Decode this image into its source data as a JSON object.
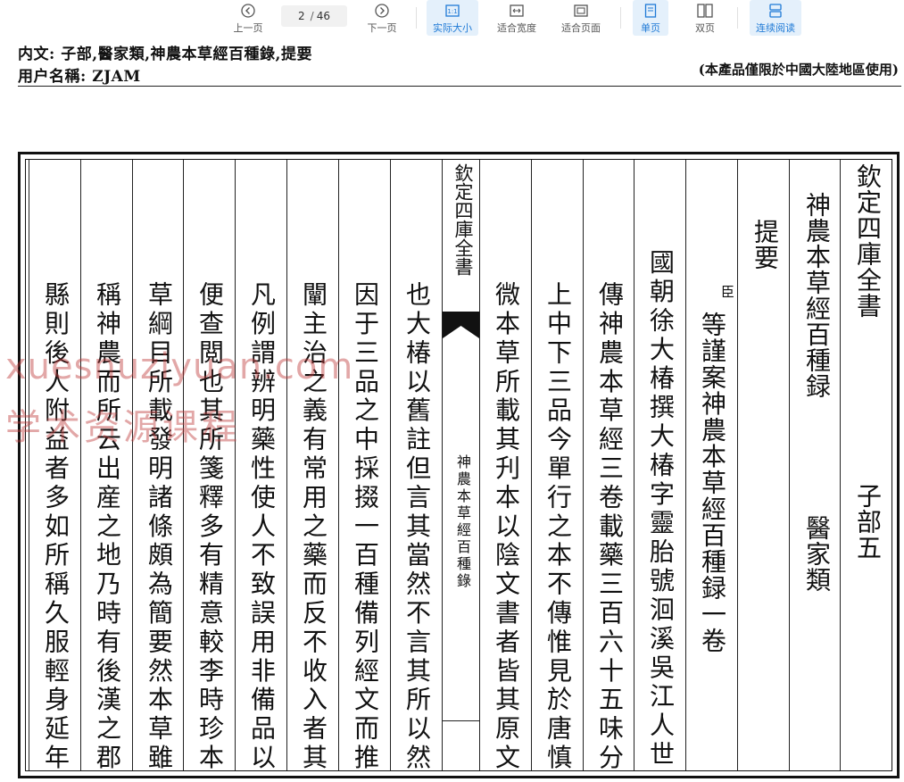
{
  "toolbar": {
    "prev_label": "上一页",
    "next_label": "下一页",
    "page_current": "2",
    "page_total": "46",
    "actual_size_label": "实际大小",
    "fit_width_label": "适合宽度",
    "fit_page_label": "适合页面",
    "single_page_label": "单页",
    "double_page_label": "双页",
    "continuous_label": "连续阅读"
  },
  "header": {
    "content_line": "内文: 子部,醫家類,神農本草經百種錄,提要",
    "user_line": "用户名稱: ZJAM",
    "notice": "(本產品僅限於中國大陸地區使用)"
  },
  "book": {
    "col_title_top": "欽定四庫全書",
    "col_title_bottom": "子部五",
    "col_book_name": "神農本草經百種録",
    "col_category": "醫家類",
    "col_abstract": "提要",
    "col_minister": "臣",
    "col_1": "等謹案神農本草經百種録一卷",
    "col_2": "國朝徐大椿撰大椿字靈胎號洄溪吳江人世",
    "col_3": "傳神農本草經三卷載藥三百六十五味分",
    "col_4": "上中下三品今單行之本不傳惟見於唐慎",
    "col_5": "微本草所載其刋本以陰文書者皆其原文",
    "center_top": "欽定四庫全書",
    "center_bottom": "神農本草經百種錄",
    "col_6": "也大椿以舊註但言其當然不言其所以然",
    "col_7": "因于三品之中採掇一百種備列經文而推",
    "col_8": "闡主治之義有常用之藥而反不收入者其",
    "col_9": "凡例謂辨明藥性使人不致誤用非備品以",
    "col_10": "便查閲也其所箋釋多有精意較李時珍本",
    "col_11": "草綱目所載發明諸條頗為簡要然本草雖",
    "col_12": "稱神農而所云出産之地乃時有後漢之郡",
    "col_13": "縣則後人附益者多如所稱久服輕身延年"
  },
  "watermark": {
    "line1": "xuesnuziyuan.com",
    "line2": "学术资源课程"
  }
}
